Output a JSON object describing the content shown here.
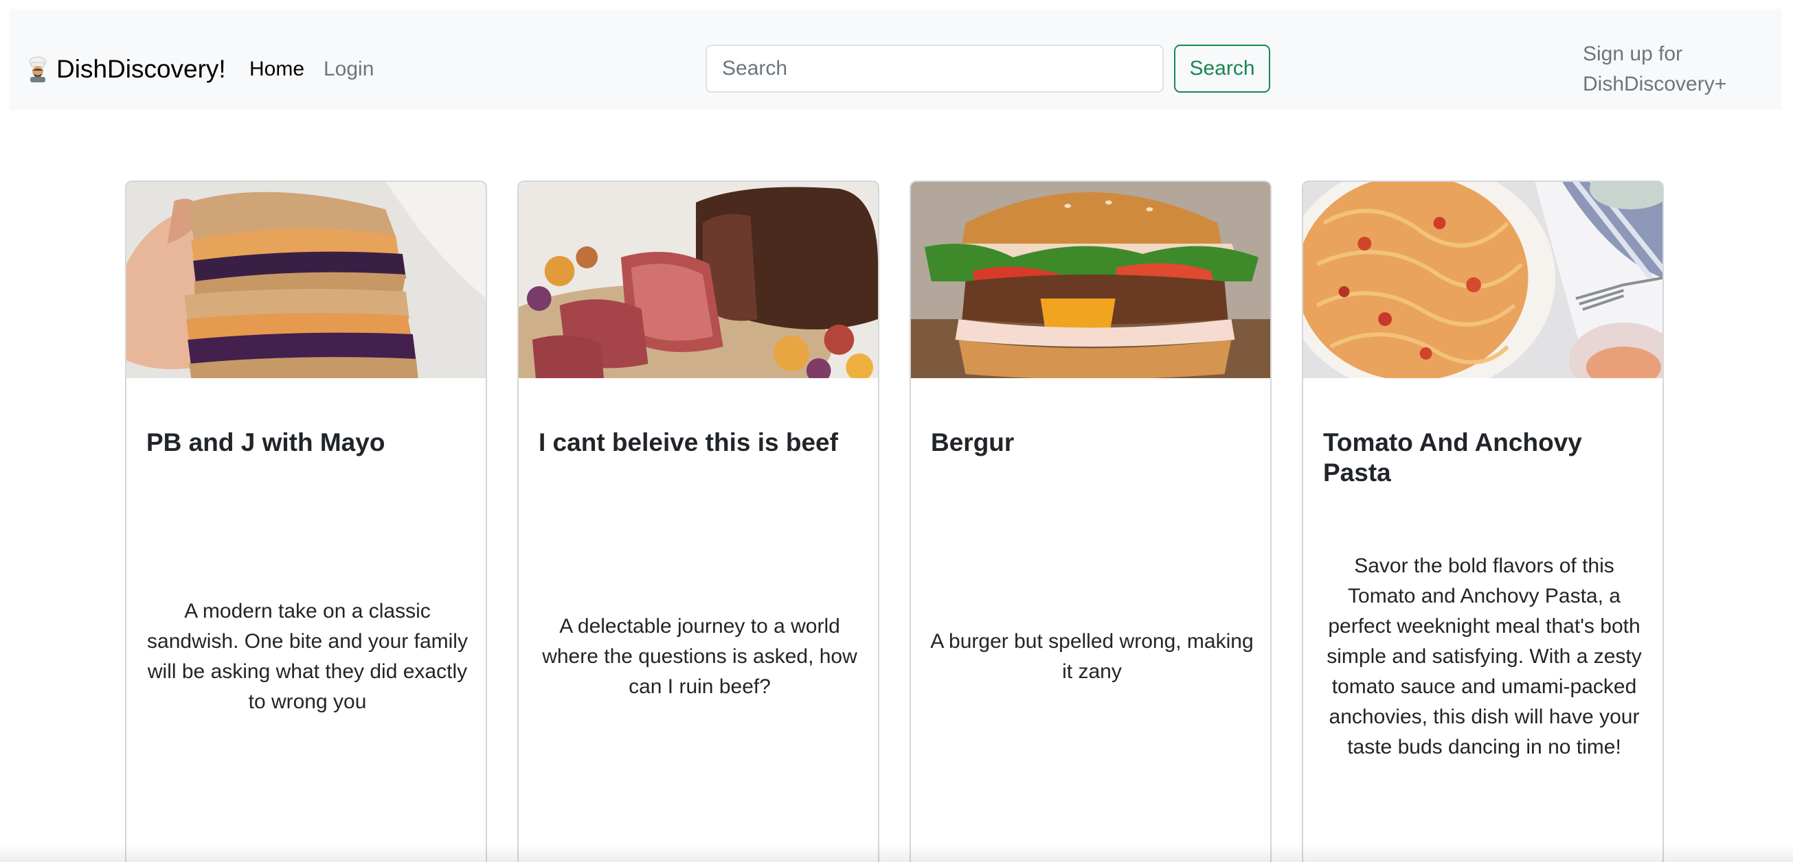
{
  "navbar": {
    "brand": "DishDiscovery!",
    "logo_icon": "chef-icon",
    "links": [
      {
        "label": "Home",
        "active": true
      },
      {
        "label": "Login",
        "active": false
      }
    ],
    "search": {
      "placeholder": "Search",
      "value": "",
      "button_label": "Search"
    },
    "signup_label": "Sign up for DishDiscovery+"
  },
  "cards": [
    {
      "title": "PB and J with Mayo",
      "description": "A modern take on a classic sandwish. One bite and your family will be asking what they did exactly to wrong you",
      "image": "peanut-butter-jelly-sandwich-photo"
    },
    {
      "title": "I cant beleive this is beef",
      "description": "A delectable journey to a world where the questions is asked, how can I ruin beef?",
      "image": "roast-beef-photo"
    },
    {
      "title": "Bergur",
      "description": "A burger but spelled wrong, making it zany",
      "image": "burger-photo"
    },
    {
      "title": "Tomato And Anchovy Pasta",
      "description": "Savor the bold flavors of this Tomato and Anchovy Pasta, a perfect weeknight meal that's both simple and satisfying. With a zesty tomato sauce and umami-packed anchovies, this dish will have your taste buds dancing in no time!",
      "image": "tomato-anchovy-pasta-photo"
    }
  ],
  "colors": {
    "navbar_bg": "#f8f9fa",
    "accent_green": "#198754",
    "muted_text": "#6c757d",
    "card_border": "#d4d6d9"
  }
}
